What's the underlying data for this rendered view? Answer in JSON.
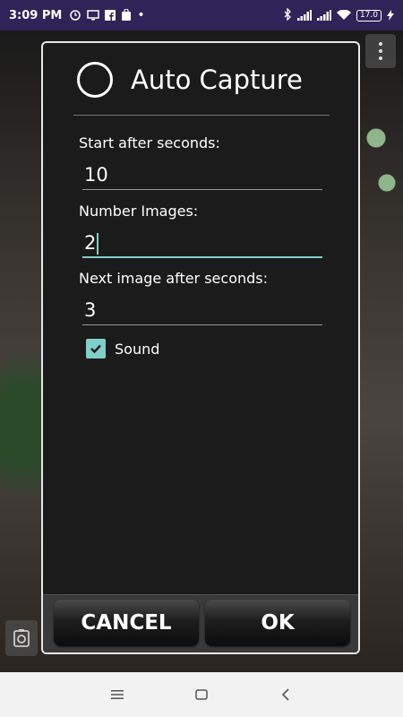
{
  "status_bar": {
    "time": "3:09 PM",
    "battery": "17.0",
    "icons": [
      "alarm-icon",
      "monitor-icon",
      "facebook-icon",
      "bag-icon",
      "bluetooth-icon",
      "signal-icon",
      "wifi-icon",
      "charging-icon"
    ]
  },
  "dialog": {
    "title": "Auto Capture",
    "fields": {
      "start_label": "Start after seconds:",
      "start_value": "10",
      "number_label": "Number Images:",
      "number_value": "2",
      "next_label": "Next image after seconds:",
      "next_value": "3"
    },
    "sound": {
      "label": "Sound",
      "checked": true
    },
    "buttons": {
      "cancel": "CANCEL",
      "ok": "OK"
    }
  },
  "colors": {
    "accent": "#7fd0c8",
    "status_bar": "#2e2458",
    "dialog_bg": "#1b1b1b"
  }
}
